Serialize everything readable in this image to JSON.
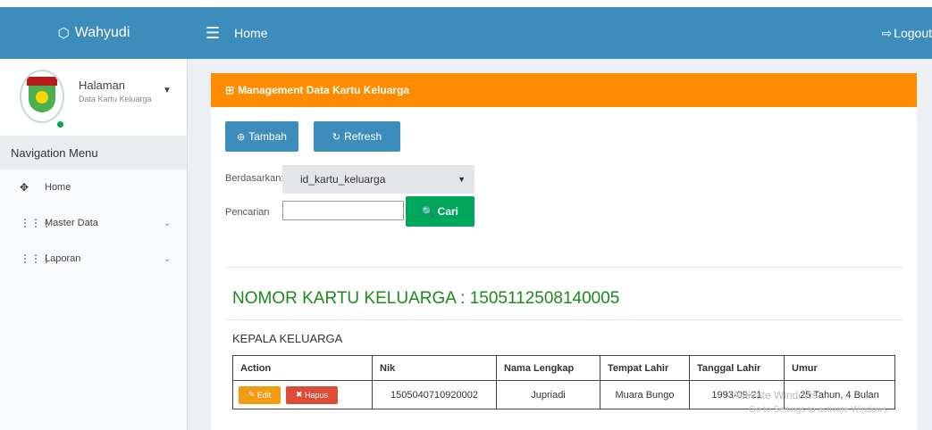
{
  "brand": {
    "name": "Wahyudi",
    "icon": "cube-icon"
  },
  "topbar": {
    "menu_icon": "☰",
    "title": "Home",
    "logout_label": "Logout",
    "logout_icon": "sign-out-icon"
  },
  "user_panel": {
    "name": "Halaman",
    "subtitle": "Data Kartu Keluarga",
    "caret": "▼"
  },
  "sidebar": {
    "header": "Navigation Menu",
    "items": [
      {
        "label": "Home",
        "icon": "✥",
        "icon_name": "arrows-icon",
        "arrow": ""
      },
      {
        "label": "Master Data",
        "icon": "⋮⋮⋮",
        "icon_name": "grid-icon",
        "arrow": "⌄"
      },
      {
        "label": "Laporan",
        "icon": "⋮⋮⋮",
        "icon_name": "grid-icon",
        "arrow": "⌄"
      }
    ]
  },
  "panel": {
    "title": "Management Data Kartu Keluarga",
    "title_icon": "⊞",
    "tambah_label": "Tambah",
    "tambah_icon": "⊕",
    "refresh_label": "Refresh",
    "refresh_icon": "↻",
    "berdasarkan_label": "Berdasarkan:",
    "select_value": "id_kartu_keluarga",
    "pencarian_label": "Pencarian",
    "search_value": "",
    "cari_label": "Cari",
    "cari_icon": "🔍"
  },
  "kk": {
    "title": "NOMOR KARTU KELUARGA : 1505112508140005",
    "section": "KEPALA KELUARGA"
  },
  "table": {
    "headers": [
      "Action",
      "Nik",
      "Nama Lengkap",
      "Tempat Lahir",
      "Tanggal Lahir",
      "Umur"
    ],
    "rows": [
      {
        "edit_label": "Edit",
        "hapus_label": "Hapus",
        "nik": "1505040710920002",
        "nama": "Jupriadi",
        "tempat": "Muara Bungo",
        "tanggal": "1993-09-21",
        "umur": "25 Tahun, 4 Bulan"
      }
    ]
  },
  "watermark": {
    "line1": "Activate Windows",
    "line2": "Go to Settings to activate Windows."
  },
  "colors": {
    "header_blue": "#3c8dbc",
    "panel_orange": "#ff8c00",
    "green": "#00a65a",
    "title_green": "#1a8a1a",
    "edit_yellow": "#f39c12",
    "hapus_red": "#dd4b39"
  }
}
